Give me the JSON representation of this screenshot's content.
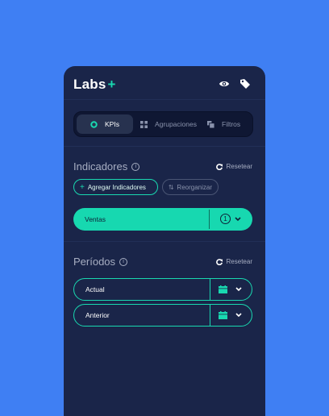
{
  "header": {
    "logo": "Labs",
    "logo_plus": "+"
  },
  "tabs": [
    {
      "label": "KPIs",
      "icon": "target-icon",
      "active": true
    },
    {
      "label": "Agrupaciones",
      "icon": "grid-icon",
      "active": false
    },
    {
      "label": "Filtros",
      "icon": "filter-icon",
      "active": false
    }
  ],
  "indicadores": {
    "title": "Indicadores",
    "info": "i",
    "reset": "Resetear",
    "add_label": "Agregar Indicadores",
    "add_plus": "+",
    "reorg_label": "Reorganizar",
    "item": {
      "label": "Ventas",
      "count": "1"
    }
  },
  "periodos": {
    "title": "Períodos",
    "info": "i",
    "reset": "Resetear",
    "items": [
      {
        "label": "Actual"
      },
      {
        "label": "Anterior"
      }
    ]
  },
  "colors": {
    "accent": "#19d8b0",
    "panel": "#1a2549",
    "background": "#3f7ff3"
  }
}
